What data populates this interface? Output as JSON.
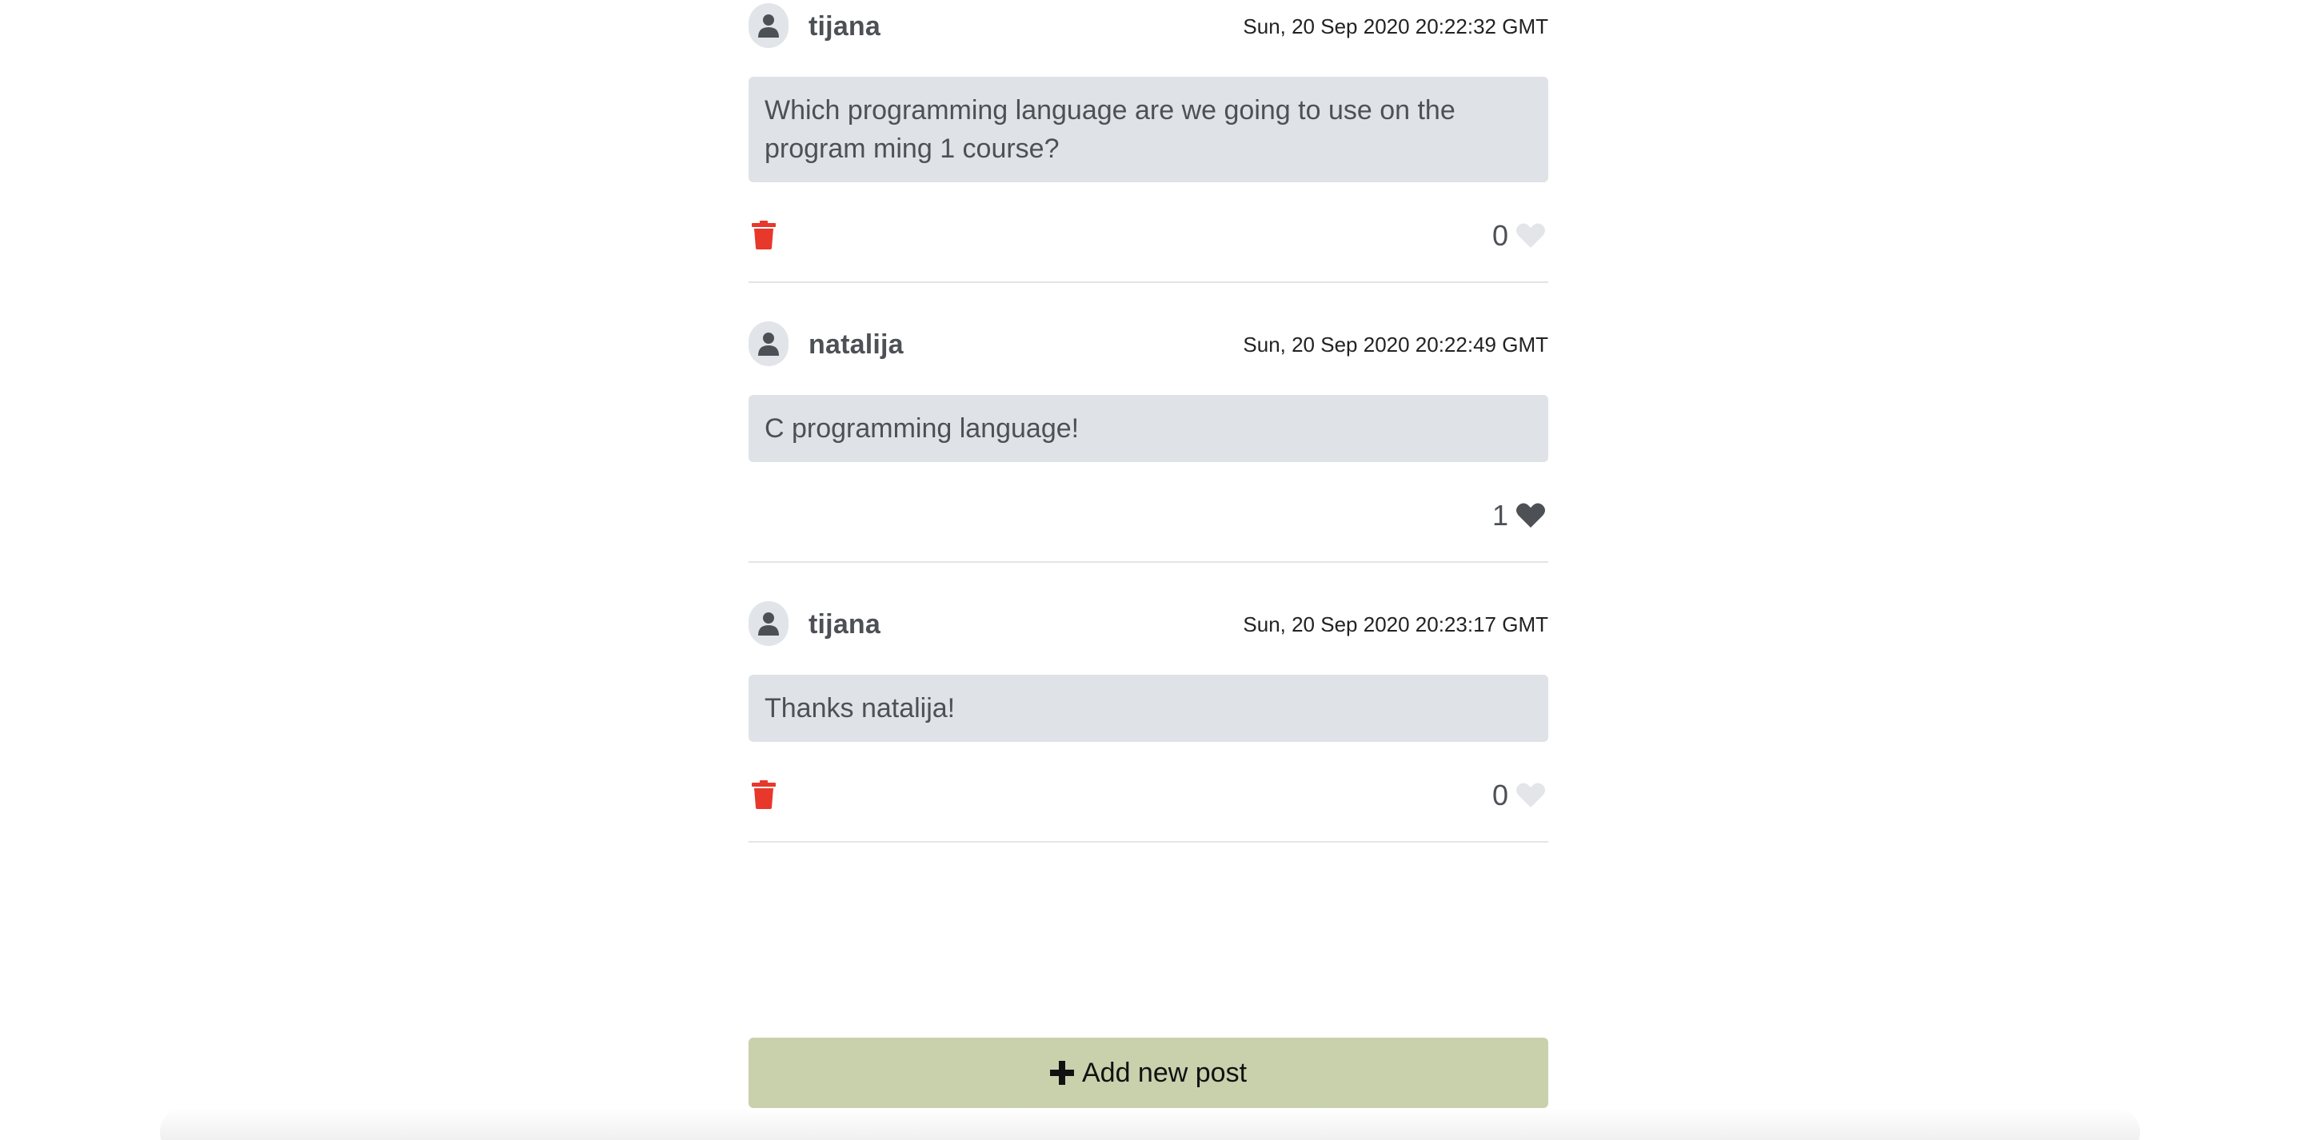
{
  "posts": [
    {
      "username": "tijana",
      "timestamp": "Sun, 20 Sep 2020 20:22:32 GMT",
      "text": "Which programming language are we going to use on the program ming 1 course?",
      "likes": "0",
      "liked": false,
      "deletable": true
    },
    {
      "username": "natalija",
      "timestamp": "Sun, 20 Sep 2020 20:22:49 GMT",
      "text": "C programming language!",
      "likes": "1",
      "liked": true,
      "deletable": false
    },
    {
      "username": "tijana",
      "timestamp": "Sun, 20 Sep 2020 20:23:17 GMT",
      "text": "Thanks natalija!",
      "likes": "0",
      "liked": false,
      "deletable": true
    }
  ],
  "add_button": {
    "label": "Add new post"
  },
  "icons": {
    "avatar": "user-icon",
    "delete": "trash-icon",
    "like": "heart-icon",
    "add": "plus-icon"
  },
  "colors": {
    "trash": "#e8382b",
    "heart_liked": "#4d5156",
    "heart_unliked": "#e3e5e8",
    "bubble_bg": "#dfe2e6",
    "add_button_bg": "#c8d1ac"
  }
}
